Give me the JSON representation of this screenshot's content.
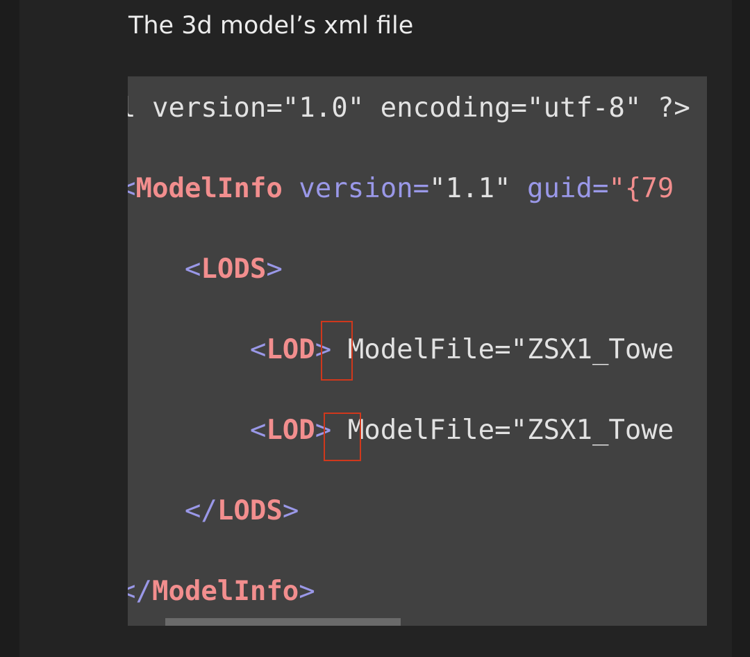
{
  "heading": "The 3d model’s xml file",
  "code": {
    "lines": [
      [
        {
          "t": "l",
          "c": "text"
        },
        {
          "t": " version=\"1.0\" encoding=\"utf-8\" ?>",
          "c": "text"
        }
      ],
      [
        {
          "t": "<",
          "c": "punct"
        },
        {
          "t": "ModelInfo",
          "c": "tag"
        },
        {
          "t": " version=",
          "c": "attr"
        },
        {
          "t": "\"1.1\"",
          "c": "text"
        },
        {
          "t": " guid=",
          "c": "attr"
        },
        {
          "t": "\"{79",
          "c": "str"
        }
      ],
      [
        {
          "t": "    ",
          "c": "text"
        },
        {
          "t": "<",
          "c": "punct"
        },
        {
          "t": "LODS",
          "c": "tag"
        },
        {
          "t": ">",
          "c": "punct"
        }
      ],
      [
        {
          "t": "        ",
          "c": "text"
        },
        {
          "t": "<",
          "c": "punct"
        },
        {
          "t": "LOD",
          "c": "tag"
        },
        {
          "t": ">",
          "c": "punct"
        },
        {
          "t": " ModelFile=\"ZSX1_Towe",
          "c": "text"
        }
      ],
      [
        {
          "t": "        ",
          "c": "text"
        },
        {
          "t": "<",
          "c": "punct"
        },
        {
          "t": "LOD",
          "c": "tag"
        },
        {
          "t": ">",
          "c": "punct"
        },
        {
          "t": " ModelFile=\"ZSX1_Towe",
          "c": "text"
        }
      ],
      [
        {
          "t": "    ",
          "c": "text"
        },
        {
          "t": "</",
          "c": "punct"
        },
        {
          "t": "LODS",
          "c": "tag"
        },
        {
          "t": ">",
          "c": "punct"
        }
      ],
      [
        {
          "t": "</",
          "c": "punct"
        },
        {
          "t": "ModelInfo",
          "c": "tag"
        },
        {
          "t": ">",
          "c": "punct"
        }
      ]
    ]
  },
  "colors": {
    "code_background": "#414141",
    "tag": "#f28e8e",
    "punctuation": "#9a98e8",
    "plain_text": "#e2e2e2",
    "highlight_border": "#d0381c"
  }
}
